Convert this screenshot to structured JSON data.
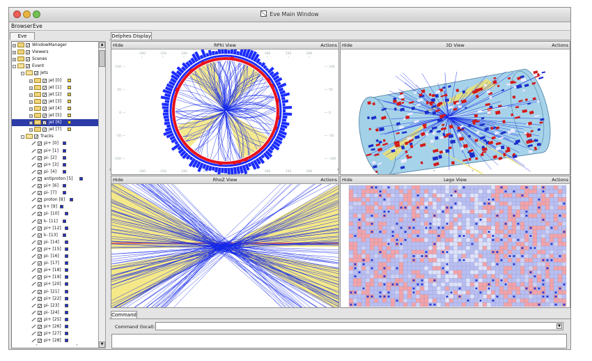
{
  "window": {
    "title": "Eve Main Window"
  },
  "menu": [
    "Browser",
    "Eve"
  ],
  "left_tab": "Eve",
  "tree": [
    {
      "label": "WindowManager",
      "indent": 0,
      "type": "folder",
      "tw": "+"
    },
    {
      "label": "Viewers",
      "indent": 0,
      "type": "folder",
      "tw": "+"
    },
    {
      "label": "Scenes",
      "indent": 0,
      "type": "folder",
      "tw": "+"
    },
    {
      "label": "Event",
      "indent": 0,
      "type": "folder",
      "tw": "-",
      "open": true
    },
    {
      "label": "Jets",
      "indent": 1,
      "type": "folder",
      "tw": "-",
      "open": true
    },
    {
      "label": "jet [0]",
      "indent": 2,
      "type": "folder",
      "tw": "+",
      "swatch": "#f0d22a"
    },
    {
      "label": "jet [1]",
      "indent": 2,
      "type": "folder",
      "tw": "+",
      "swatch": "#f0d22a"
    },
    {
      "label": "jet [2]",
      "indent": 2,
      "type": "folder",
      "tw": "+",
      "swatch": "#f0d22a"
    },
    {
      "label": "jet [3]",
      "indent": 2,
      "type": "folder",
      "tw": "+",
      "swatch": "#f0d22a"
    },
    {
      "label": "jet [4]",
      "indent": 2,
      "type": "folder",
      "tw": "+",
      "swatch": "#f0d22a"
    },
    {
      "label": "jet [5]",
      "indent": 2,
      "type": "folder",
      "tw": "+",
      "swatch": "#f0d22a"
    },
    {
      "label": "jet [6]",
      "indent": 2,
      "type": "folder",
      "tw": "+",
      "swatch": "#f0d22a",
      "selected": true
    },
    {
      "label": "jet [7]",
      "indent": 2,
      "type": "folder",
      "tw": "+",
      "swatch": "#f0d22a"
    },
    {
      "label": "Tracks",
      "indent": 1,
      "type": "folder",
      "tw": "-",
      "open": true
    },
    {
      "label": "pi+ [0]",
      "indent": 2,
      "type": "leaf",
      "swatch": "#1f2fd0"
    },
    {
      "label": "pi+ [1]",
      "indent": 2,
      "type": "leaf",
      "swatch": "#1f2fd0"
    },
    {
      "label": "pi- [2]",
      "indent": 2,
      "type": "leaf",
      "swatch": "#1f2fd0"
    },
    {
      "label": "pi+ [3]",
      "indent": 2,
      "type": "leaf",
      "swatch": "#1f2fd0"
    },
    {
      "label": "pi- [4]",
      "indent": 2,
      "type": "leaf",
      "swatch": "#1f2fd0"
    },
    {
      "label": "antiproton [5]",
      "indent": 2,
      "type": "leaf",
      "swatch": "#1f2fd0"
    },
    {
      "label": "pi+ [6]",
      "indent": 2,
      "type": "leaf",
      "swatch": "#1f2fd0"
    },
    {
      "label": "pi- [7]",
      "indent": 2,
      "type": "leaf",
      "swatch": "#1f2fd0"
    },
    {
      "label": "proton [8]",
      "indent": 2,
      "type": "leaf",
      "swatch": "#1f2fd0"
    },
    {
      "label": "k+ [9]",
      "indent": 2,
      "type": "leaf",
      "swatch": "#1f2fd0"
    },
    {
      "label": "pi- [10]",
      "indent": 2,
      "type": "leaf",
      "swatch": "#1f2fd0"
    },
    {
      "label": "k- [11]",
      "indent": 2,
      "type": "leaf",
      "swatch": "#1f2fd0"
    },
    {
      "label": "pi+ [12]",
      "indent": 2,
      "type": "leaf",
      "swatch": "#1f2fd0"
    },
    {
      "label": "k- [13]",
      "indent": 2,
      "type": "leaf",
      "swatch": "#1f2fd0"
    },
    {
      "label": "pi- [14]",
      "indent": 2,
      "type": "leaf",
      "swatch": "#1f2fd0"
    },
    {
      "label": "pi+ [15]",
      "indent": 2,
      "type": "leaf",
      "swatch": "#1f2fd0"
    },
    {
      "label": "pi- [16]",
      "indent": 2,
      "type": "leaf",
      "swatch": "#1f2fd0"
    },
    {
      "label": "pi- [17]",
      "indent": 2,
      "type": "leaf",
      "swatch": "#1f2fd0"
    },
    {
      "label": "pi+ [18]",
      "indent": 2,
      "type": "leaf",
      "swatch": "#1f2fd0"
    },
    {
      "label": "pi+ [19]",
      "indent": 2,
      "type": "leaf",
      "swatch": "#1f2fd0"
    },
    {
      "label": "pi+ [20]",
      "indent": 2,
      "type": "leaf",
      "swatch": "#1f2fd0"
    },
    {
      "label": "pi- [21]",
      "indent": 2,
      "type": "leaf",
      "swatch": "#1f2fd0"
    },
    {
      "label": "pi+ [22]",
      "indent": 2,
      "type": "leaf",
      "swatch": "#1f2fd0"
    },
    {
      "label": "pi- [23]",
      "indent": 2,
      "type": "leaf",
      "swatch": "#1f2fd0"
    },
    {
      "label": "pi- [24]",
      "indent": 2,
      "type": "leaf",
      "swatch": "#1f2fd0"
    },
    {
      "label": "pi+ [25]",
      "indent": 2,
      "type": "leaf",
      "swatch": "#1f2fd0"
    },
    {
      "label": "pi+ [26]",
      "indent": 2,
      "type": "leaf",
      "swatch": "#1f2fd0"
    },
    {
      "label": "pi+ [27]",
      "indent": 2,
      "type": "leaf",
      "swatch": "#1f2fd0"
    },
    {
      "label": "pi+ [28]",
      "indent": 2,
      "type": "leaf",
      "swatch": "#1f2fd0"
    }
  ],
  "display_tab": "Delphes Display",
  "views": {
    "rphi": {
      "hide": "Hide",
      "title": "RPhi View",
      "actions": "Actions"
    },
    "threed": {
      "hide": "Hide",
      "title": "3D View",
      "actions": "Actions"
    },
    "rhoz": {
      "hide": "Hide",
      "title": "RhoZ View",
      "actions": "Actions"
    },
    "lego": {
      "hide": "Hide",
      "title": "Lego View",
      "actions": "Actions"
    }
  },
  "rphi_axes": {
    "top": [
      "-200",
      "-150",
      "-100",
      "-50",
      "0",
      "50",
      "100",
      "150",
      "200"
    ],
    "left": [
      "100",
      "50",
      "0",
      "-50",
      "-100"
    ],
    "right": [
      "100",
      "50",
      "0",
      "-50",
      "-100"
    ]
  },
  "command": {
    "tab": "Command",
    "label": "Command (local):",
    "value": ""
  },
  "colors": {
    "track": "#1428e8",
    "calo_ecal": "#e8131b",
    "calo_hcal": "#1a2cff",
    "jet": "#f1e26a",
    "selection": "#2b3ba8",
    "lego_bg": "#b9bff2",
    "lego_hot": "#f4a3a8"
  }
}
